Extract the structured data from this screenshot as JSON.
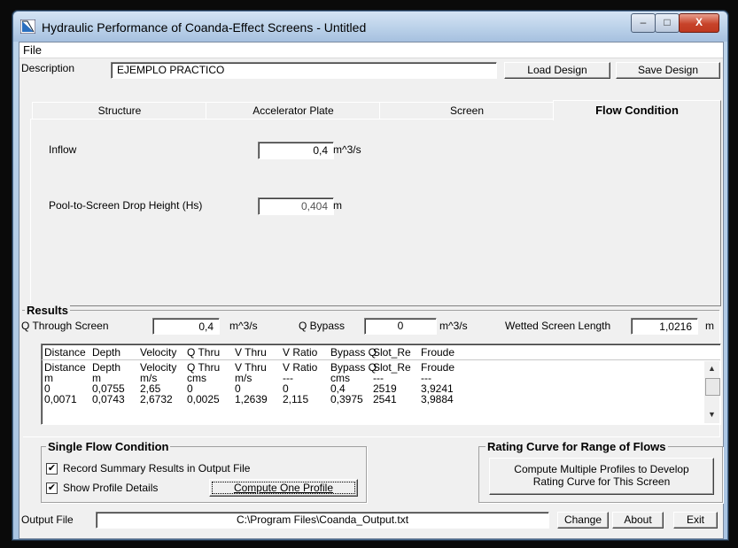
{
  "window": {
    "title": "Hydraulic Performance of Coanda-Effect Screens - Untitled",
    "minimize": "–",
    "maximize": "□",
    "close": "X"
  },
  "menu": {
    "file": "File"
  },
  "description": {
    "label": "Description",
    "value": "EJEMPLO PRACTICO"
  },
  "buttons": {
    "load_design": "Load Design",
    "save_design": "Save Design"
  },
  "tabs": [
    {
      "label": "Structure"
    },
    {
      "label": "Accelerator Plate"
    },
    {
      "label": "Screen"
    },
    {
      "label": "Flow Condition"
    }
  ],
  "flow": {
    "inflow_label": "Inflow",
    "inflow_value": "0,4",
    "inflow_unit": "m^3/s",
    "drop_label": "Pool-to-Screen Drop Height (Hs)",
    "drop_value": "0,404",
    "drop_unit": "m"
  },
  "results": {
    "title": "Results",
    "q_through_label": "Q Through Screen",
    "q_through_value": "0,4",
    "q_through_unit": "m^3/s",
    "q_bypass_label": "Q Bypass",
    "q_bypass_value": "0",
    "q_bypass_unit": "m^3/s",
    "wetted_label": "Wetted Screen Length",
    "wetted_value": "1,0216",
    "wetted_unit": "m",
    "header": [
      "Distance",
      "Depth",
      "Velocity",
      "Q Thru",
      "V Thru",
      "V Ratio",
      "Bypass Q",
      "Slot_Re",
      "Froude"
    ],
    "rows": [
      [
        "Distance",
        "Depth",
        "Velocity",
        "Q Thru",
        "V Thru",
        "V Ratio",
        "Bypass Q",
        "Slot_Re",
        "Froude"
      ],
      [
        "m",
        "m",
        "m/s",
        "cms",
        "m/s",
        "---",
        "cms",
        "---",
        "---"
      ],
      [
        "0",
        "0,0755",
        "2,65",
        "0",
        "0",
        "0",
        "0,4",
        "2519",
        "3,9241"
      ],
      [
        "0,0071",
        "0,0743",
        "2,6732",
        "0,0025",
        "1,2639",
        "2,115",
        "0,3975",
        "2541",
        "3,9884"
      ]
    ]
  },
  "single_flow": {
    "title": "Single Flow Condition",
    "record_label": "Record Summary Results in Output File",
    "record_checked": "✔",
    "show_label": "Show Profile Details",
    "show_checked": "✔",
    "compute_button": "Compute One Profile"
  },
  "rating": {
    "title": "Rating Curve for Range of Flows",
    "button_line1": "Compute Multiple Profiles to Develop",
    "button_line2": "Rating Curve for This Screen"
  },
  "output": {
    "label": "Output File",
    "path": "C:\\Program Files\\Coanda_Output.txt",
    "change": "Change",
    "about": "About",
    "exit": "Exit"
  },
  "icons": {
    "app": "coanda-app-icon",
    "scroll_up": "scroll-up-arrow-icon",
    "scroll_down": "scroll-down-arrow-icon"
  }
}
